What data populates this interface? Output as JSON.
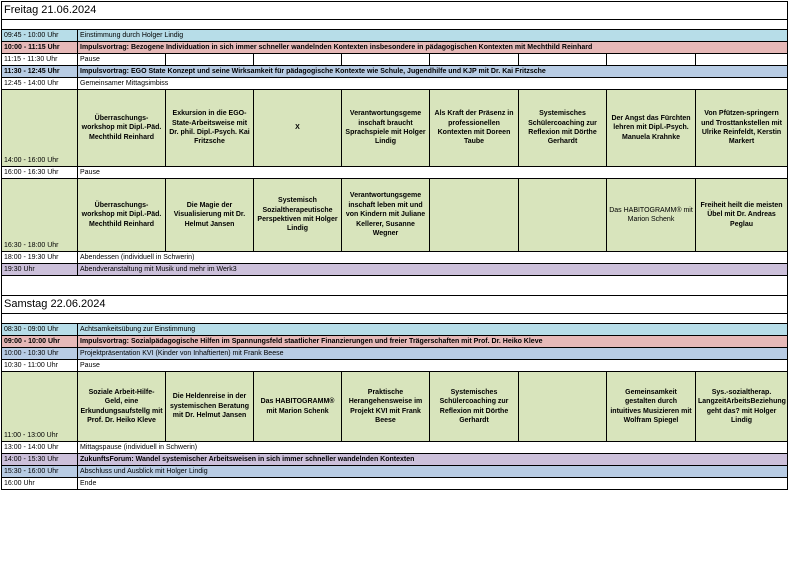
{
  "colors": {
    "blue": "#b7dde8",
    "pink": "#e6b9b8",
    "steel": "#b8cce4",
    "lavender": "#ccc0da",
    "green": "#d8e4bc"
  },
  "friday": {
    "title": "Freitag   21.06.2024",
    "rows": {
      "r1": {
        "time": "09:45 - 10:00 Uhr",
        "text": "Einstimmung durch Holger Lindig"
      },
      "r2": {
        "time": "10:00 - 11:15 Uhr",
        "text": "Impulsvortrag: Bezogene Individuation in sich immer schneller wandelnden Kontexten insbesondere in pädagogischen Kontexten mit Mechthild Reinhard"
      },
      "r3": {
        "time": "11:15 - 11:30 Uhr",
        "text": "Pause"
      },
      "r4": {
        "time": "11:30 - 12:45 Uhr",
        "text": "Impulsvortrag: EGO State Konzept und seine Wirksamkeit für pädagogische Kontexte wie Schule, Jugendhilfe und KJP  mit Dr. Kai Fritzsche"
      },
      "r5": {
        "time": "12:45 - 14:00 Uhr",
        "text": "Gemeinsamer Mittagsimbiss"
      },
      "ws1_time": "14:00 - 16:00 Uhr",
      "ws1": [
        "Überraschungs-workshop mit Dipl.-Päd. Mechthild Reinhard",
        "Exkursion in die EGO-State-Arbeitsweise mit Dr. phil. Dipl.-Psych. Kai Fritzsche",
        "X",
        "Verantwortungsgeme inschaft braucht Sprachspiele mit Holger Lindig",
        "Als Kraft der Präsenz in professionellen Kontexten mit Doreen Taube",
        "Systemisches Schülercoaching zur Reflexion mit Dörthe Gerhardt",
        "Der Angst das Fürchten lehren mit Dipl.-Psych. Manuela Krahnke",
        "Von Pfützen-springern und Trosttankstellen mit Ulrike Reinfeldt, Kerstin Markert"
      ],
      "r6": {
        "time": "16:00 - 16:30 Uhr",
        "text": "Pause"
      },
      "ws2_time": "16:30 - 18:00 Uhr",
      "ws2": [
        "Überraschungs-workshop mit Dipl.-Päd. Mechthild Reinhard",
        "Die Magie der Visualisierung mit Dr. Helmut Jansen",
        "Systemisch Sozialtherapeutische Perspektiven mit Holger Lindig",
        "Verantwortungsgeme inschaft leben mit und von Kindern mit Juliane Kellerer, Susanne Wegner",
        "",
        "",
        "Das HABITOGRAMM® mit Marion Schenk",
        "Freiheit heilt die meisten Übel mit Dr. Andreas Peglau"
      ],
      "r7": {
        "time": "18:00 - 19:30 Uhr",
        "text": "Abendessen (individuell in Schwerin)"
      },
      "r8": {
        "time": "19:30 Uhr",
        "text": "Abendveranstaltung mit Musik und mehr im Werk3"
      }
    }
  },
  "saturday": {
    "title": "Samstag   22.06.2024",
    "rows": {
      "r1": {
        "time": "08:30 - 09:00 Uhr",
        "text": "Achtsamkeitsübung zur Einstimmung"
      },
      "r2": {
        "time": "09:00 - 10:00 Uhr",
        "text": "Impulsvortrag: Sozialpädagogische Hilfen im Spannungsfeld staatlicher Finanzierungen und freier Trägerschaften mit Prof. Dr. Heiko Kleve"
      },
      "r3": {
        "time": "10:00 - 10:30 Uhr",
        "text": "Projektpräsentation KVI (Kinder von Inhaftierten) mit Frank Beese"
      },
      "r4": {
        "time": "10:30 - 11:00 Uhr",
        "text": "Pause"
      },
      "ws_time": "11:00 - 13:00 Uhr",
      "ws": [
        "Soziale Arbeit-Hilfe-Geld, eine Erkundungsaufstellg mit Prof. Dr. Heiko Kleve",
        "Die Heldenreise in der systemischen Beratung mit Dr. Helmut Jansen",
        "Das HABITOGRAMM® mit Marion Schenk",
        "Praktische Herangehensweise im Projekt KVI mit Frank Beese",
        "Systemisches Schülercoaching zur Reflexion mit Dörthe Gerhardt",
        "",
        "Gemeinsamkeit gestalten durch intuitives Musizieren mit Wolfram Spiegel",
        "Sys.-sozialtherap. LangzeitArbeitsBeziehung geht das?  mit Holger Lindig"
      ],
      "r5": {
        "time": "13:00 - 14:00 Uhr",
        "text": "Mittagspause (individuell in Schwerin)"
      },
      "r6": {
        "time": "14:00 - 15:30 Uhr",
        "text": "ZukunftsForum: Wandel systemischer Arbeitsweisen in sich immer schneller wandelnden Kontexten"
      },
      "r7": {
        "time": "15:30 - 16:00 Uhr",
        "text": "Abschluss und Ausblick mit Holger Lindig"
      },
      "r8": {
        "time": "16:00 Uhr",
        "text": "Ende"
      }
    }
  }
}
